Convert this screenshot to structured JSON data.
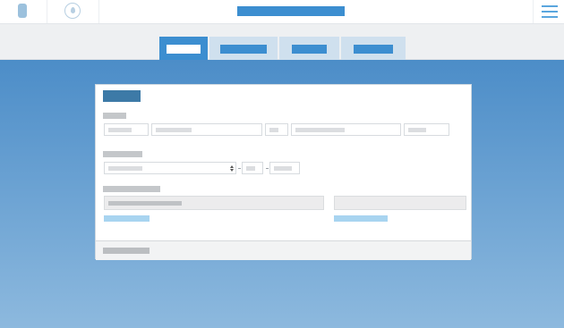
{
  "header": {
    "title": "",
    "phone_icon": "phone-icon",
    "drop_icon": "water-drop-icon",
    "menu_icon": "hamburger-menu-icon",
    "accent_color": "#3c8ed0"
  },
  "tabs": [
    {
      "label": "",
      "active": true
    },
    {
      "label": "",
      "active": false
    },
    {
      "label": "",
      "active": false
    },
    {
      "label": "",
      "active": false
    }
  ],
  "form": {
    "title": "",
    "name_label": "",
    "name_fields": [
      "",
      "",
      "",
      "",
      ""
    ],
    "date_label": "",
    "date_select_value": "",
    "date_separator": "-",
    "account_label": "",
    "account_value": "",
    "account_link": "",
    "second_value": "",
    "second_link": "",
    "footer_text": ""
  }
}
